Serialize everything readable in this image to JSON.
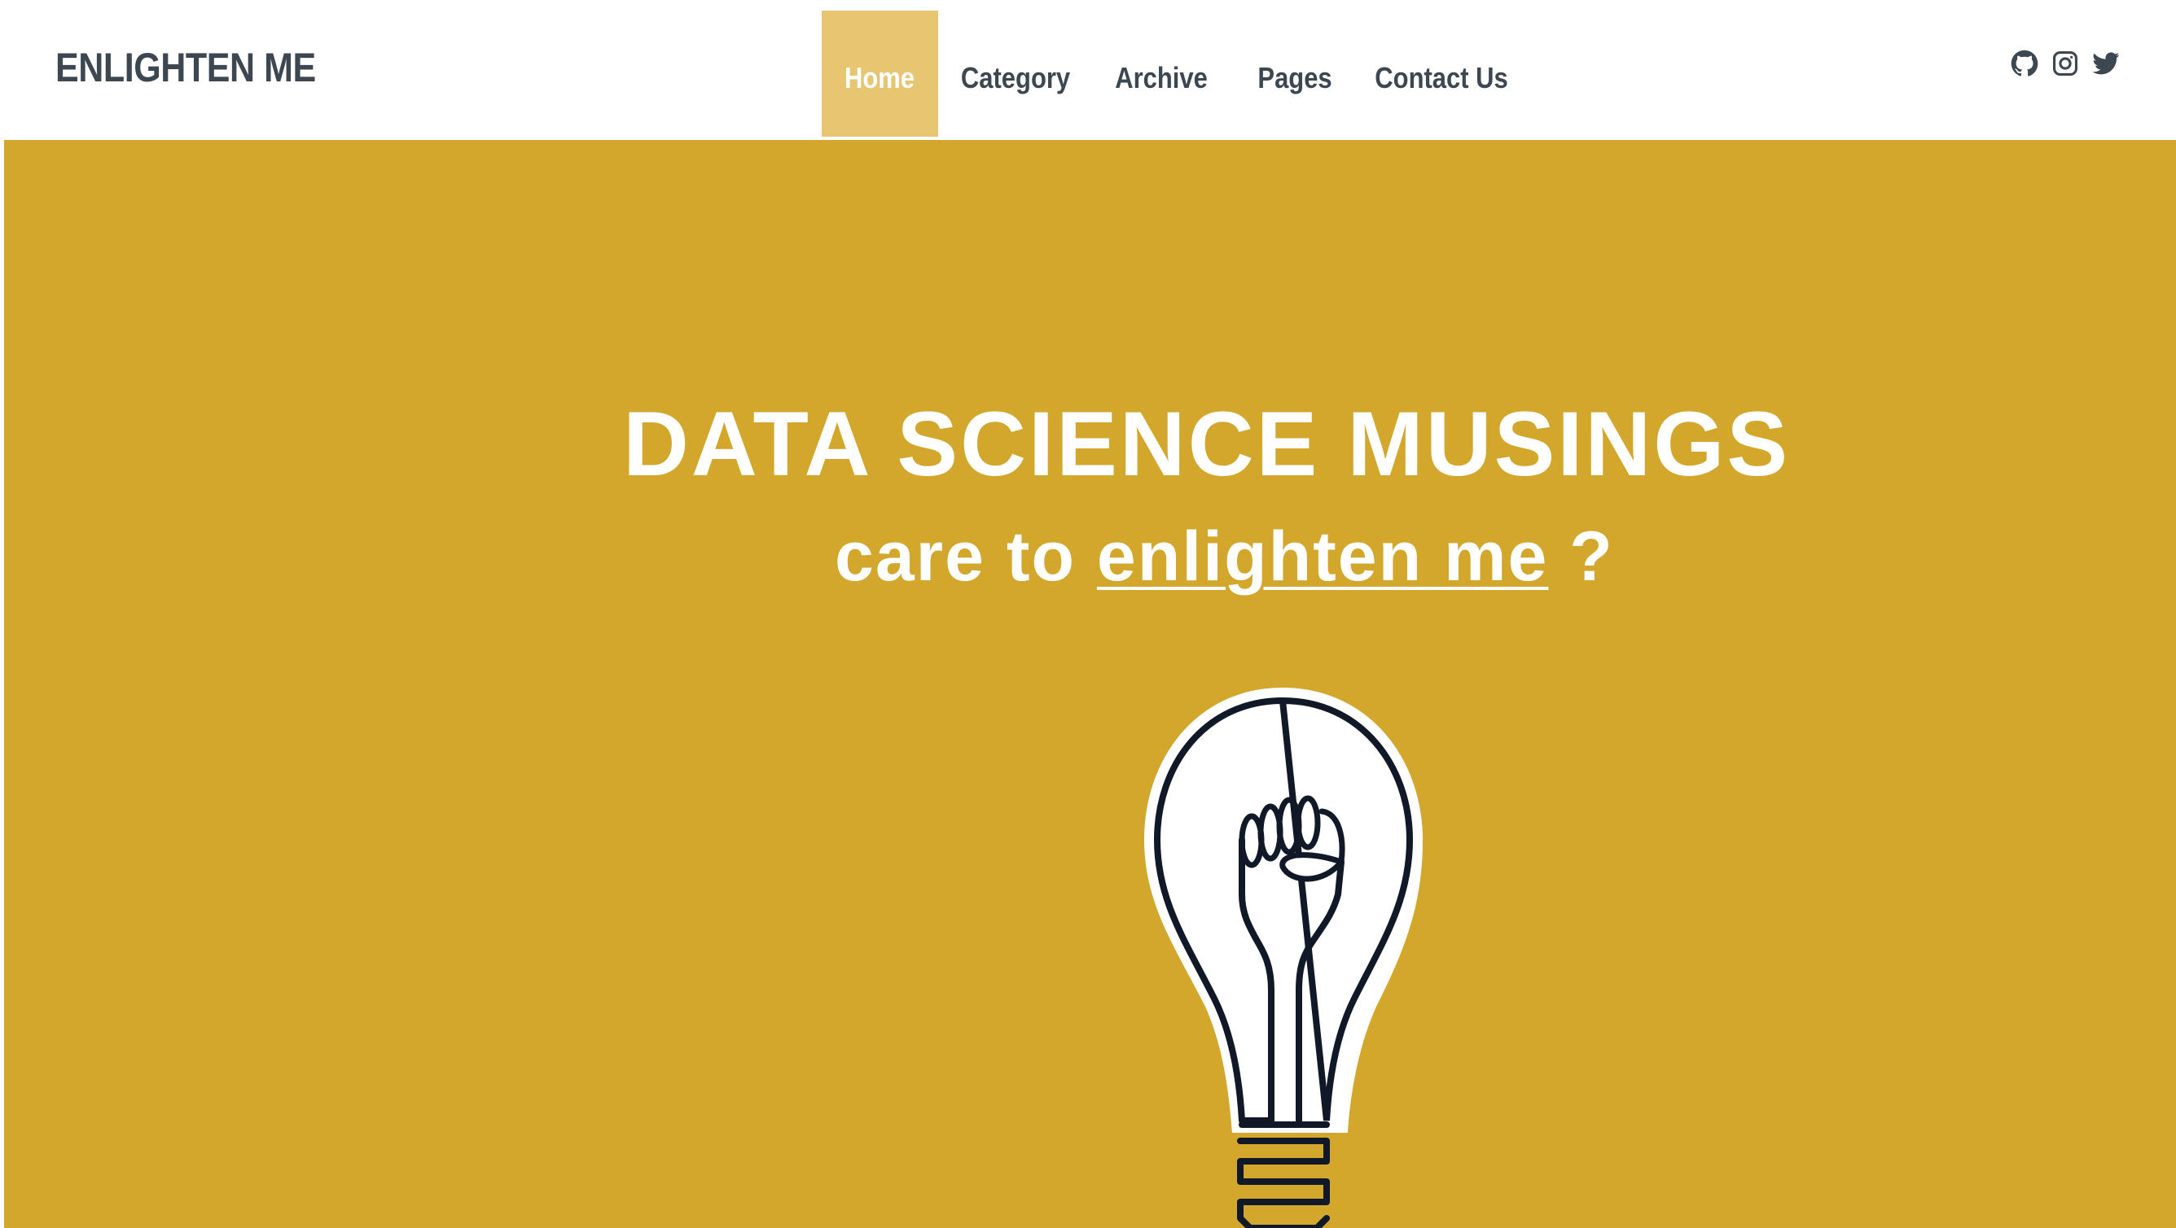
{
  "header": {
    "brand": "ENLIGHTEN ME",
    "nav": [
      {
        "label": "Home",
        "active": true
      },
      {
        "label": "Category",
        "active": false
      },
      {
        "label": "Archive",
        "active": false
      },
      {
        "label": "Pages",
        "active": false
      },
      {
        "label": "Contact Us",
        "active": false
      }
    ],
    "social": [
      {
        "icon": "github-icon"
      },
      {
        "icon": "instagram-icon"
      },
      {
        "icon": "twitter-icon"
      }
    ]
  },
  "hero": {
    "title": "DATA SCIENCE MUSINGS",
    "subtitle_prefix": "care to ",
    "subtitle_link": "enlighten me",
    "subtitle_suffix": " ?",
    "image": "lightbulb-with-raised-fist-illustration"
  },
  "colors": {
    "brand_text": "#3d4752",
    "nav_active_bg": "#e8c671",
    "hero_bg": "#d3a72c",
    "hero_text": "#ffffff",
    "bulb_outline": "#111827"
  }
}
